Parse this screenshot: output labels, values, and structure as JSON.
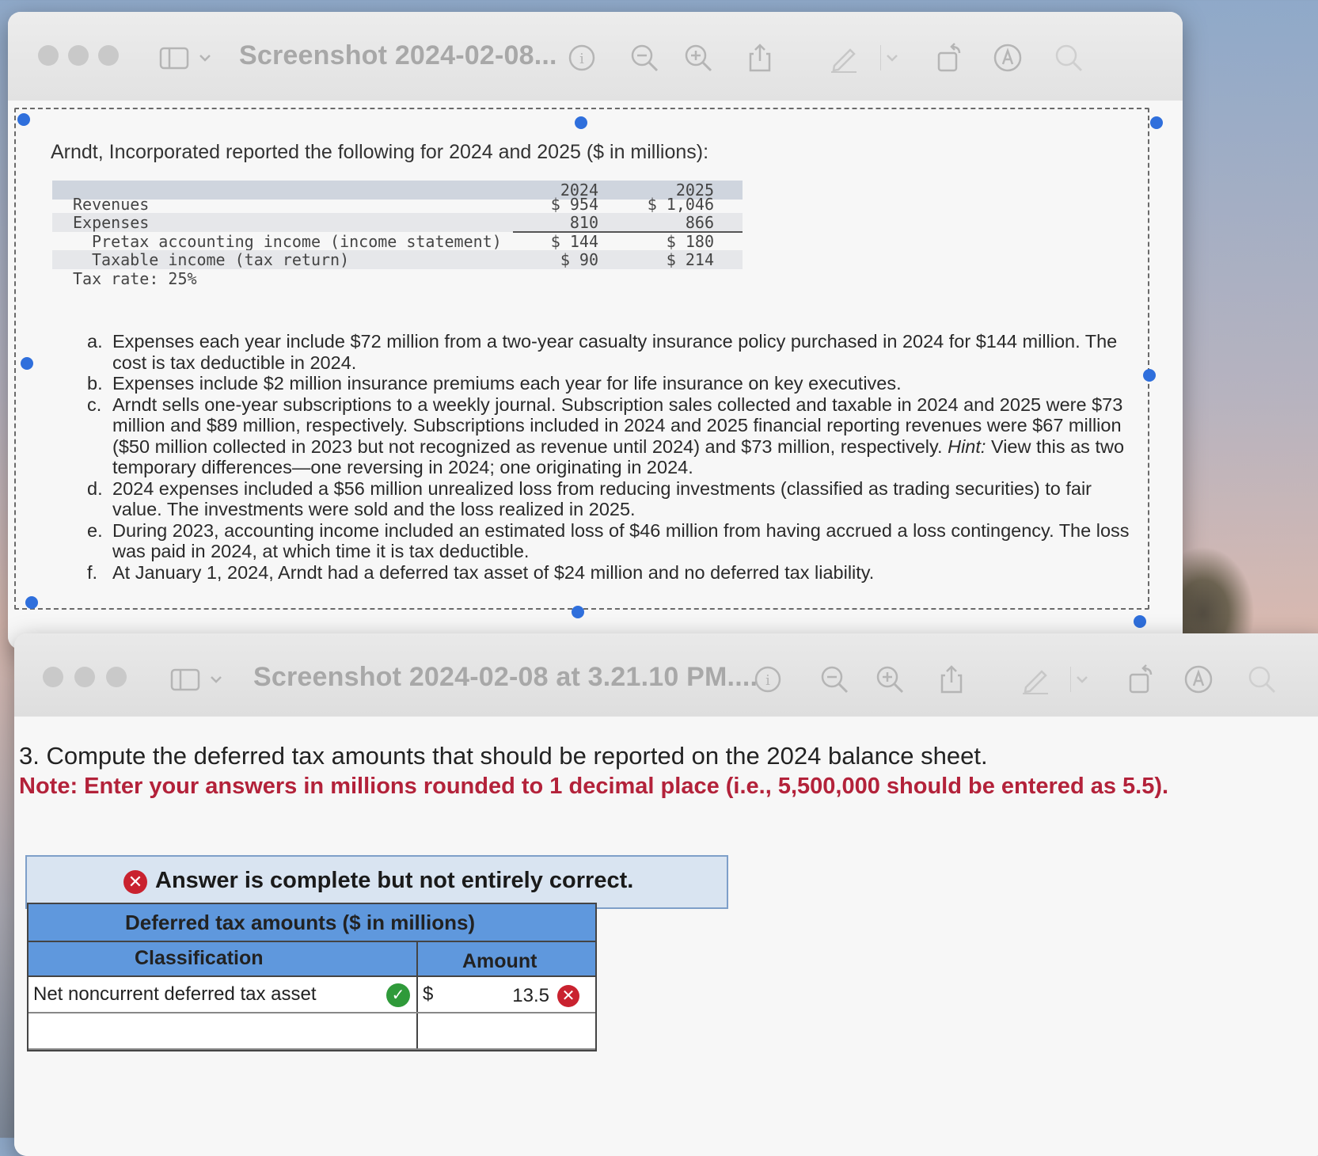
{
  "window1": {
    "title": "Screenshot 2024-02-08...",
    "toolbar_icons": [
      "sidebar-icon",
      "chevron-down-icon",
      "info-icon",
      "zoom-out-icon",
      "zoom-in-icon",
      "share-icon",
      "markup-pen-icon",
      "rotate-icon",
      "annotate-icon",
      "search-icon"
    ]
  },
  "problem": {
    "intro": "Arndt, Incorporated reported the following for 2024 and 2025 ($ in millions):",
    "table": {
      "headers": [
        "2024",
        "2025"
      ],
      "rows": [
        {
          "label": "Revenues",
          "v2024": "$ 954",
          "v2025": "$ 1,046"
        },
        {
          "label": "Expenses",
          "v2024": "810",
          "v2025": "866"
        },
        {
          "label": "Pretax accounting income (income statement)",
          "v2024": "$ 144",
          "v2025": "$ 180"
        },
        {
          "label": "Taxable income (tax return)",
          "v2024": "$ 90",
          "v2025": "$ 214"
        }
      ],
      "tax_rate": "Tax rate: 25%"
    },
    "notes": [
      {
        "label": "a.",
        "text": "Expenses each year include $72 million from a two-year casualty insurance policy purchased in 2024 for $144 million. The cost is tax deductible in 2024."
      },
      {
        "label": "b.",
        "text": "Expenses include $2 million insurance premiums each year for life insurance on key executives."
      },
      {
        "label": "c.",
        "text_before_hint": "Arndt sells one-year subscriptions to a weekly journal. Subscription sales collected and taxable in 2024 and 2025 were $73 million and $89 million, respectively. Subscriptions included in 2024 and 2025 financial reporting revenues were $67 million ($50 million collected in 2023 but not recognized as revenue until 2024) and $73 million, respectively.",
        "hint_label": "Hint:",
        "hint_text": "View this as two temporary differences—one reversing in 2024; one originating in 2024."
      },
      {
        "label": "d.",
        "text": "2024 expenses included a $56 million unrealized loss from reducing investments (classified as trading securities) to fair value. The investments were sold and the loss realized in 2025."
      },
      {
        "label": "e.",
        "text": "During 2023, accounting income included an estimated loss of $46 million from having accrued a loss contingency. The loss was paid in 2024, at which time it is tax deductible."
      },
      {
        "label": "f.",
        "text": "At January 1, 2024, Arndt had a deferred tax asset of $24 million and no deferred tax liability."
      }
    ]
  },
  "window2": {
    "title": "Screenshot 2024-02-08 at 3.21.10 PM....",
    "toolbar_icons": [
      "sidebar-icon",
      "chevron-down-icon",
      "info-icon",
      "zoom-out-icon",
      "zoom-in-icon",
      "share-icon",
      "markup-pen-icon",
      "rotate-icon",
      "annotate-icon",
      "search-icon"
    ]
  },
  "question": {
    "title": "3. Compute the deferred tax amounts that should be reported on the 2024 balance sheet.",
    "note": "Note: Enter your answers in millions rounded to 1 decimal place (i.e., 5,500,000 should be entered as 5.5)."
  },
  "result_banner": "Answer is complete but not entirely correct.",
  "answer_table": {
    "caption": "Deferred tax amounts ($ in millions)",
    "col_classification": "Classification",
    "col_amount": "Amount",
    "rows": [
      {
        "classification": "Net noncurrent deferred tax asset",
        "currency": "$",
        "amount": "13.5",
        "classification_status": "correct",
        "amount_status": "incorrect"
      }
    ]
  },
  "colors": {
    "handle_blue": "#2f6fdc",
    "table_header_blue": "#5f98dd",
    "banner_bg": "#d9e4f1",
    "error_red": "#c9222f",
    "note_red": "#b3223a",
    "correct_green": "#2f9a3a"
  }
}
